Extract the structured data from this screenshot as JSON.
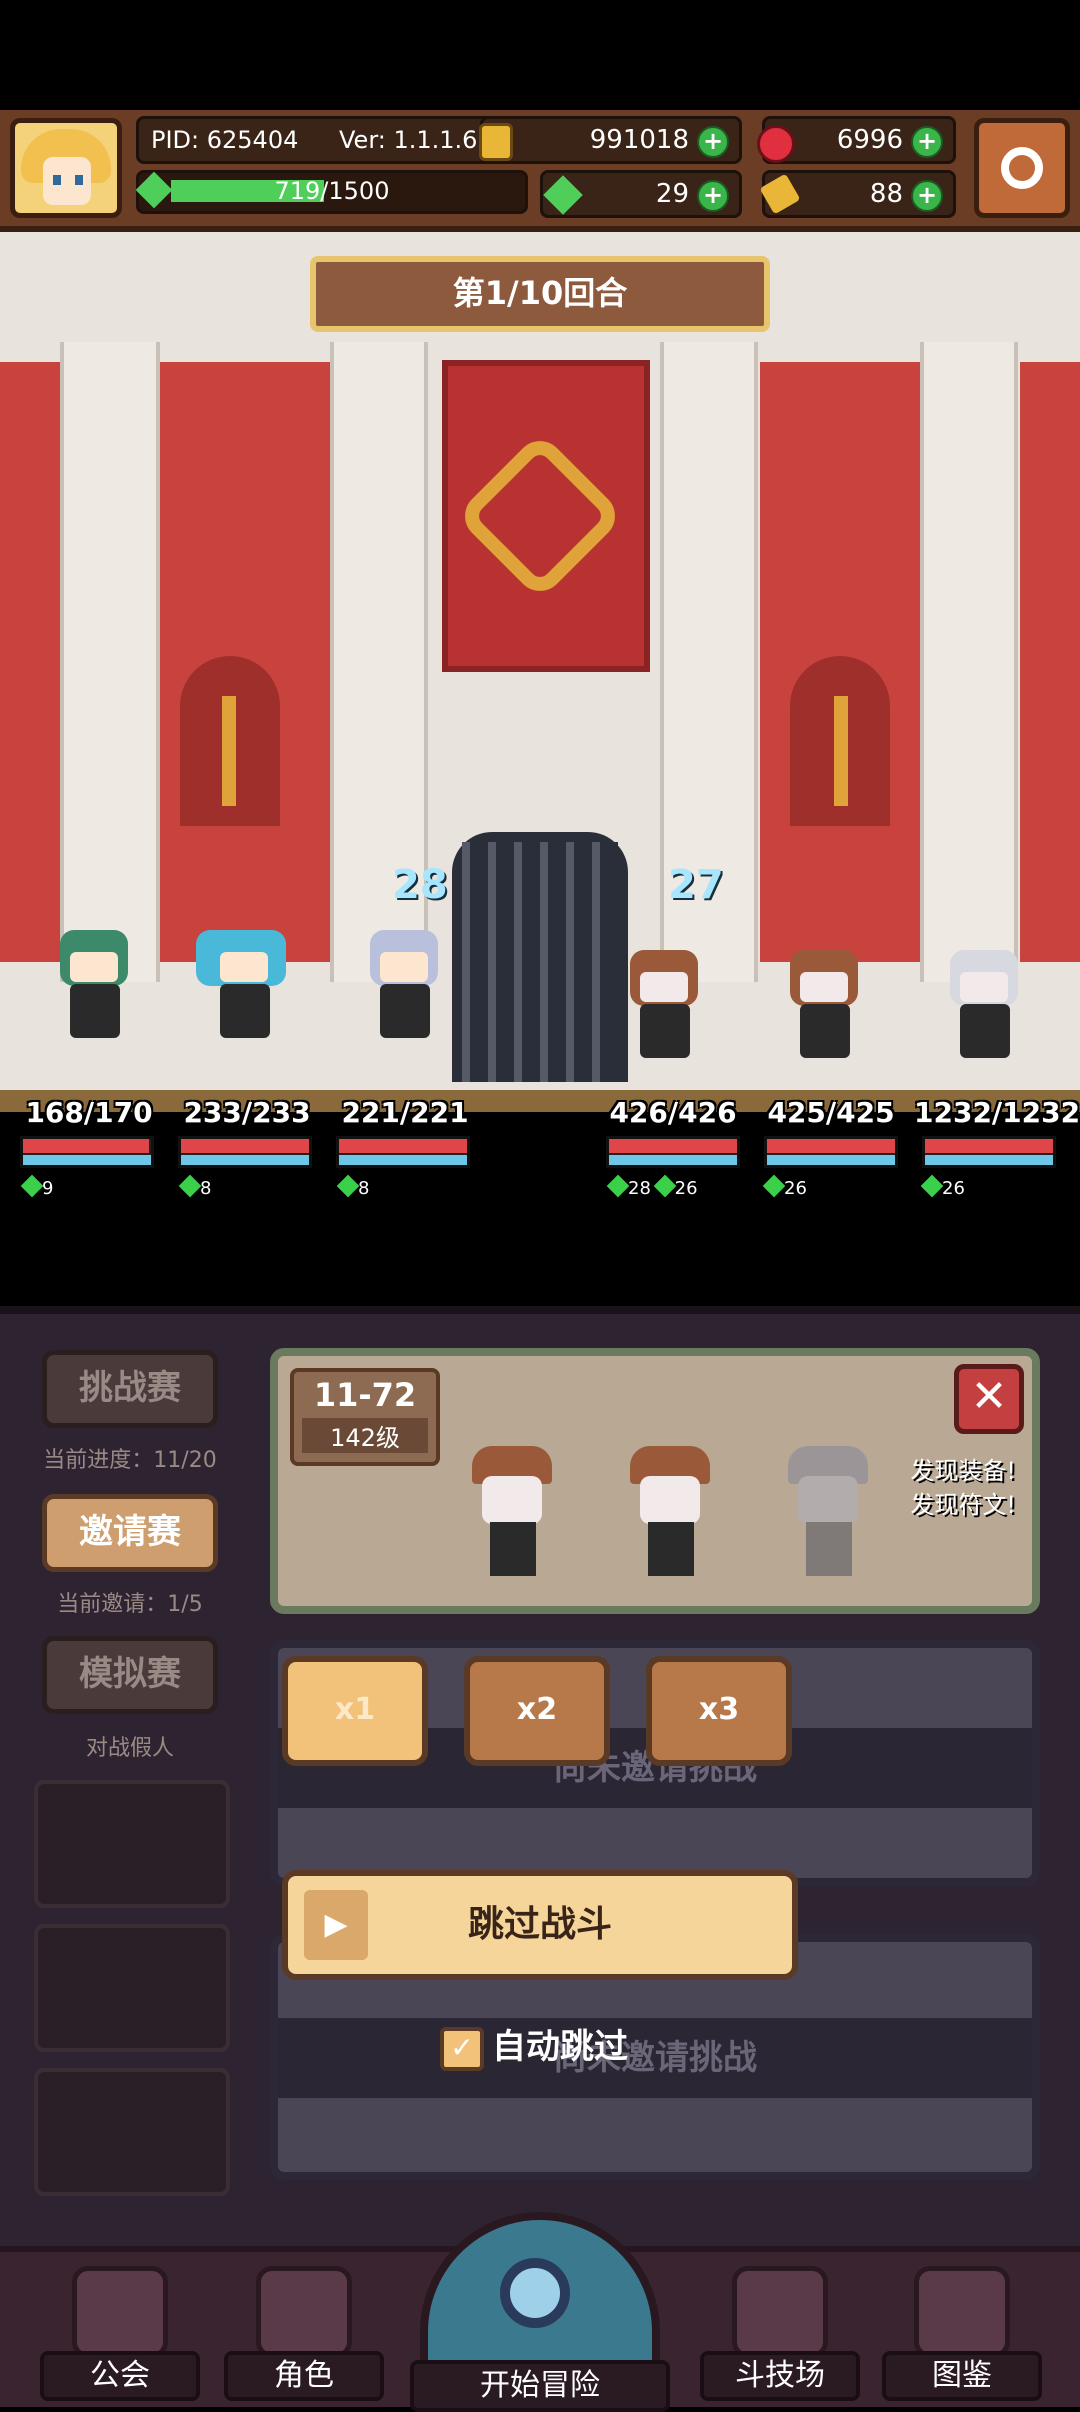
{
  "header": {
    "pid": "PID: 625404",
    "version": "Ver: 1.1.1.6",
    "xp_text": "719/1500",
    "xp_progress": 0.479,
    "gold": "991018",
    "gem": "6996",
    "clover": "29",
    "key": "88"
  },
  "battle": {
    "round": "第1/10回合",
    "allies": [
      {
        "hp": "168/170",
        "hp_ratio": 0.988,
        "buff": "9"
      },
      {
        "hp": "233/233",
        "hp_ratio": 1.0,
        "buff": "8"
      },
      {
        "hp": "221/221",
        "hp_ratio": 1.0,
        "buff": "8",
        "shield": "28"
      }
    ],
    "enemies": [
      {
        "hp": "426/426",
        "hp_ratio": 1.0,
        "buffs": [
          "28",
          "26"
        ],
        "shield": "27"
      },
      {
        "hp": "425/425",
        "hp_ratio": 1.0,
        "buff": "26"
      },
      {
        "hp": "1232/1232",
        "hp_ratio": 1.0,
        "buff": "26"
      }
    ]
  },
  "arena": {
    "tabs": [
      {
        "label": "挑战赛",
        "sub": "当前进度：11/20"
      },
      {
        "label": "邀请赛",
        "sub": "当前邀请：1/5"
      },
      {
        "label": "模拟赛",
        "sub": "对战假人"
      }
    ],
    "stage": "11-72",
    "level": "142级",
    "found_equip": "发现装备!",
    "found_rune": "发现符文!",
    "ghost_text_1": "尚未邀请挑战",
    "ghost_text_2": "尚未邀请挑战",
    "speeds": [
      "x1",
      "x2",
      "x3"
    ],
    "skip_label": "跳过战斗",
    "auto_skip_label": "自动跳过"
  },
  "nav": {
    "guild": "公会",
    "role": "角色",
    "adventure": "开始冒险",
    "arena": "斗技场",
    "codex": "图鉴"
  },
  "colors": {
    "hp": "#e0454a",
    "mp": "#6fc7e8",
    "accent": "#f5d59a",
    "buff": "#3ad04a"
  }
}
